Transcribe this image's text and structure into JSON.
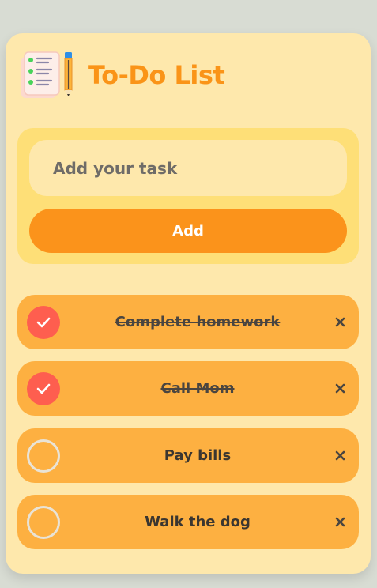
{
  "app": {
    "title": "To-Do List",
    "icon": "notepad-pencil-icon"
  },
  "input": {
    "placeholder": "Add your task",
    "value": ""
  },
  "add_button": {
    "label": "Add"
  },
  "tasks": [
    {
      "text": "Complete homework",
      "completed": true
    },
    {
      "text": "Call Mom",
      "completed": true
    },
    {
      "text": "Pay bills",
      "completed": false
    },
    {
      "text": "Walk the dog",
      "completed": false
    }
  ],
  "icons": {
    "completed": "check-icon",
    "pending": "empty-circle-icon",
    "remove": "close-icon"
  },
  "colors": {
    "page_background": "#d8dcd3",
    "card_background": "#fee8ac",
    "accent_orange": "#fb931b",
    "title_orange": "#fa9418",
    "task_background": "#fdb041",
    "completed_red": "#fe5e4f",
    "input_panel": "#fedf77"
  }
}
